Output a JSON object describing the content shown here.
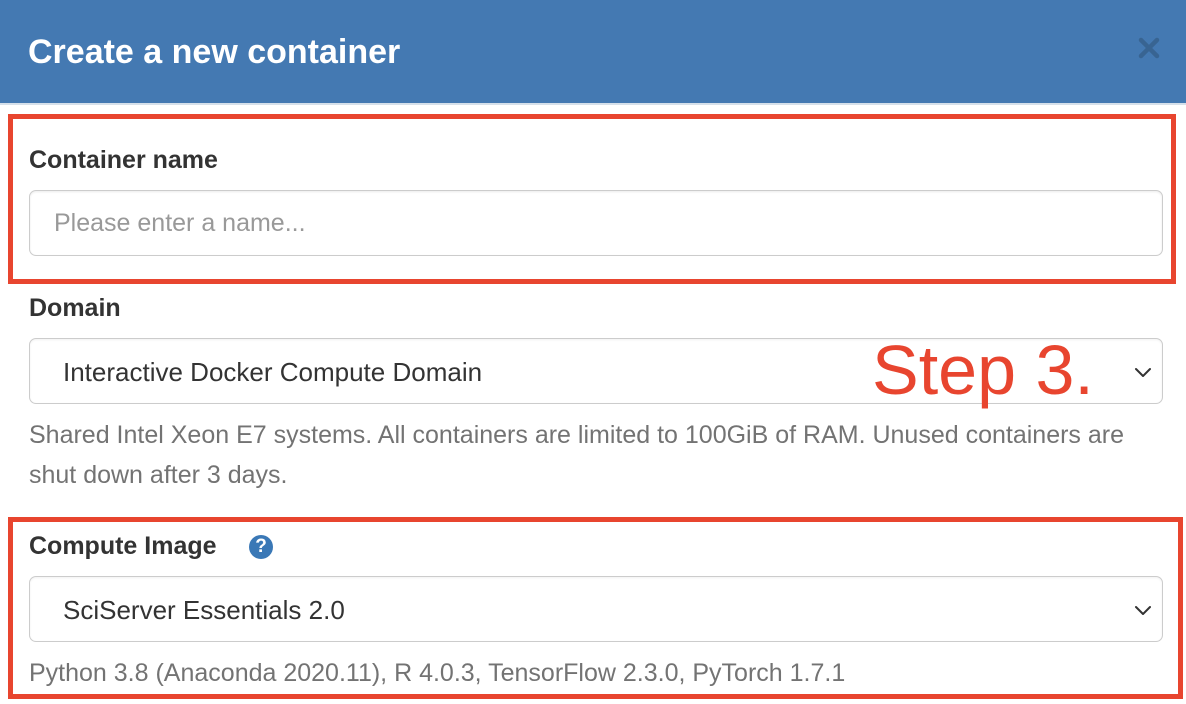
{
  "modal": {
    "title": "Create a new container",
    "close_symbol": "×"
  },
  "fields": {
    "container_name": {
      "label": "Container name",
      "value": "",
      "placeholder": "Please enter a name..."
    },
    "domain": {
      "label": "Domain",
      "selected": "Interactive Docker Compute Domain",
      "description": "Shared Intel Xeon E7 systems. All containers are limited to 100GiB of RAM. Unused containers are shut down after 3 days."
    },
    "compute_image": {
      "label": "Compute Image",
      "help_icon": "?",
      "selected": "SciServer Essentials 2.0",
      "description": "Python 3.8 (Anaconda 2020.11), R 4.0.3, TensorFlow 2.3.0, PyTorch 1.7.1"
    }
  },
  "annotation": {
    "step_text": "Step 3.",
    "color": "#e8452f"
  },
  "colors": {
    "header_bg": "#4479b2",
    "help_icon_bg": "#3a78b6"
  },
  "icons": {
    "close": "close-icon",
    "chevron": "chevron-down-icon",
    "help": "question-circle-icon"
  }
}
